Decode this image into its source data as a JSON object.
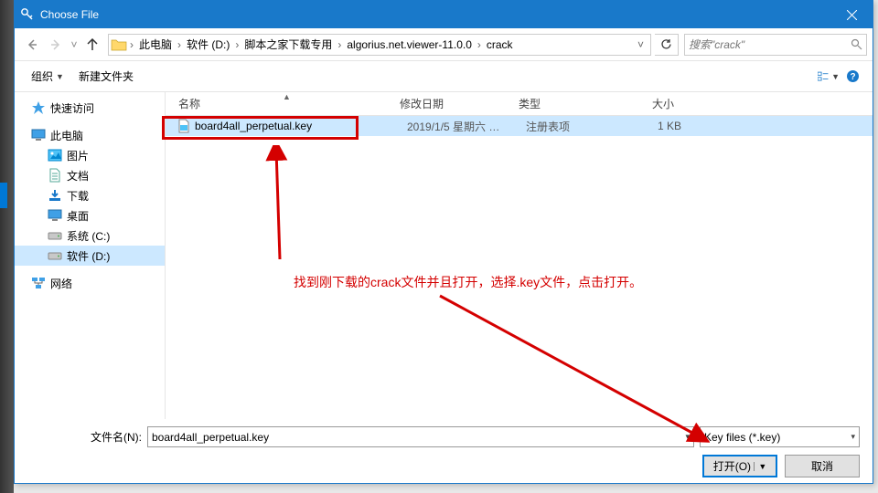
{
  "window": {
    "title": "Choose File"
  },
  "nav": {
    "crumbs": [
      "此电脑",
      "软件 (D:)",
      "脚本之家下载专用",
      "algorius.net.viewer-11.0.0",
      "crack"
    ],
    "search_placeholder": "搜索\"crack\""
  },
  "toolbar": {
    "organize": "组织",
    "new_folder": "新建文件夹"
  },
  "sidebar": {
    "quick_access": "快速访问",
    "this_pc": "此电脑",
    "children": [
      {
        "label": "图片",
        "icon": "pictures"
      },
      {
        "label": "文档",
        "icon": "documents"
      },
      {
        "label": "下载",
        "icon": "downloads"
      },
      {
        "label": "桌面",
        "icon": "desktop"
      },
      {
        "label": "系统 (C:)",
        "icon": "drive"
      },
      {
        "label": "软件 (D:)",
        "icon": "drive",
        "selected": true
      }
    ],
    "network": "网络"
  },
  "columns": {
    "name": "名称",
    "date": "修改日期",
    "type": "类型",
    "size": "大小"
  },
  "files": [
    {
      "name": "board4all_perpetual.key",
      "date": "2019/1/5 星期六 …",
      "type": "注册表项",
      "size": "1 KB",
      "selected": true
    }
  ],
  "footer": {
    "filename_label": "文件名(N):",
    "filename_value": "board4all_perpetual.key",
    "filter": "Key files (*.key)",
    "open": "打开(O)",
    "cancel": "取消"
  },
  "annotation": "找到刚下载的crack文件并且打开，选择.key文件，点击打开。"
}
